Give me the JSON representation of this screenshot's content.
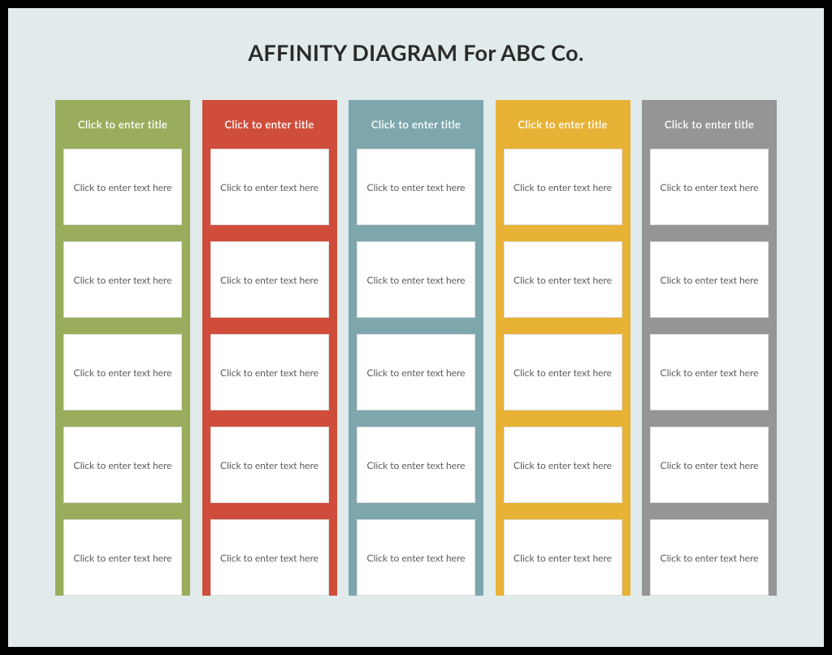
{
  "title": "AFFINITY DIAGRAM For ABC Co.",
  "columns": [
    {
      "color": "#99ad5c",
      "title": "Click to enter title",
      "cards": [
        "Click to enter text here",
        "Click to enter text here",
        "Click to enter text here",
        "Click to enter text here",
        "Click to enter text here"
      ]
    },
    {
      "color": "#d04d3c",
      "title": "Click to enter title",
      "cards": [
        "Click to enter text here",
        "Click to enter text here",
        "Click to enter text here",
        "Click to enter text here",
        "Click to enter text here"
      ]
    },
    {
      "color": "#7ea7ad",
      "title": "Click to enter title",
      "cards": [
        "Click to enter text here",
        "Click to enter text here",
        "Click to enter text here",
        "Click to enter text here",
        "Click to enter text here"
      ]
    },
    {
      "color": "#e7b235",
      "title": "Click to enter title",
      "cards": [
        "Click to enter text here",
        "Click to enter text here",
        "Click to enter text here",
        "Click to enter text here",
        "Click to enter text here"
      ]
    },
    {
      "color": "#959595",
      "title": "Click to enter title",
      "cards": [
        "Click to enter text here",
        "Click to enter text here",
        "Click to enter text here",
        "Click to enter text here",
        "Click to enter text here"
      ]
    }
  ]
}
